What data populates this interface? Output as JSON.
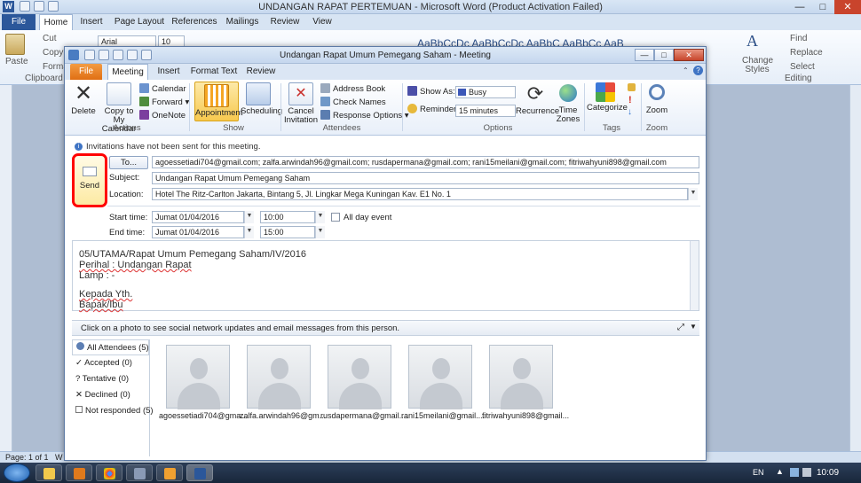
{
  "word": {
    "title": "UNDANGAN RAPAT PERTEMUAN - Microsoft Word (Product Activation Failed)",
    "tabs": [
      "File",
      "Home",
      "Insert",
      "Page Layout",
      "References",
      "Mailings",
      "Review",
      "View"
    ],
    "font_name": "Arial",
    "font_size": "10",
    "clipboard": {
      "paste": "Paste",
      "cut": "Cut",
      "copy": "Copy",
      "format": "Format",
      "group": "Clipboard"
    },
    "styles_preview": "AaBbCcDc  AaBbCcDc  AaBbC  AaBbCc  AaB",
    "editing": {
      "find": "Find",
      "replace": "Replace",
      "select": "Select",
      "change_styles": "Change Styles",
      "group": "Editing"
    },
    "status_page": "Page: 1 of 1",
    "status_w": "W"
  },
  "meeting": {
    "title": "Undangan Rapat Umum Pemegang Saham - Meeting",
    "tabs": [
      "File",
      "Meeting",
      "Insert",
      "Format Text",
      "Review"
    ],
    "actions": {
      "delete": "Delete",
      "copy_to_calendar": "Copy to My Calendar",
      "calendar": "Calendar",
      "forward": "Forward",
      "onenote": "OneNote",
      "group": "Actions"
    },
    "show": {
      "appointment": "Appointment",
      "scheduling": "Scheduling",
      "group": "Show"
    },
    "attendees": {
      "cancel": "Cancel Invitation",
      "address_book": "Address Book",
      "check_names": "Check Names",
      "response_options": "Response Options",
      "group": "Attendees"
    },
    "options": {
      "show_as_label": "Show As:",
      "show_as_value": "Busy",
      "reminder_label": "Reminder:",
      "reminder_value": "15 minutes",
      "recurrence": "Recurrence",
      "time_zones": "Time Zones",
      "group": "Options"
    },
    "tags": {
      "categorize": "Categorize",
      "group": "Tags"
    },
    "zoom": {
      "zoom": "Zoom",
      "group": "Zoom"
    },
    "info_bar": "Invitations have not been sent for this meeting.",
    "send": "Send",
    "to_button": "To...",
    "to_value": "agoessetiadi704@gmail.com; zalfa.arwindah96@gmail.com; rusdapermana@gmail.com; rani15meilani@gmail.com; fitriwahyuni898@gmail.com",
    "subject_label": "Subject:",
    "subject_value": "Undangan Rapat Umum Pemegang Saham",
    "location_label": "Location:",
    "location_value": "Hotel The Ritz-Carlton Jakarta, Bintang 5, Jl. Lingkar Mega Kuningan Kav. E1 No. 1",
    "start_label": "Start time:",
    "start_date": "Jumat 01/04/2016",
    "start_time": "10:00",
    "all_day": "All day event",
    "end_label": "End time:",
    "end_date": "Jumat 01/04/2016",
    "end_time": "15:00",
    "body": {
      "line1": "05/UTAMA/Rapat Umum Pemegang Saham/IV/2016",
      "line2": "Perihal : Undangan Rapat",
      "line3": "Lamp : -",
      "line4": "Kepada Yth.",
      "line5": "Bapak/Ibu"
    },
    "social_bar": "Click on a photo to see social network updates and email messages from this person.",
    "people": [
      {
        "label": "All Attendees (5)"
      },
      {
        "label": "Accepted (0)"
      },
      {
        "label": "Tentative (0)"
      },
      {
        "label": "Declined (0)"
      },
      {
        "label": "Not responded (5)"
      }
    ],
    "photos": [
      "agoessetiadi704@gma...",
      "zalfa.arwindah96@gm...",
      "rusdapermana@gmail....",
      "rani15meilani@gmail....",
      "fitriwahyuni898@gmail..."
    ]
  },
  "taskbar": {
    "lang": "EN",
    "time": "10:09"
  },
  "colors": {
    "accent": "#2b579a",
    "outlook_file": "#e06f13",
    "highlight": "#ff0000"
  }
}
